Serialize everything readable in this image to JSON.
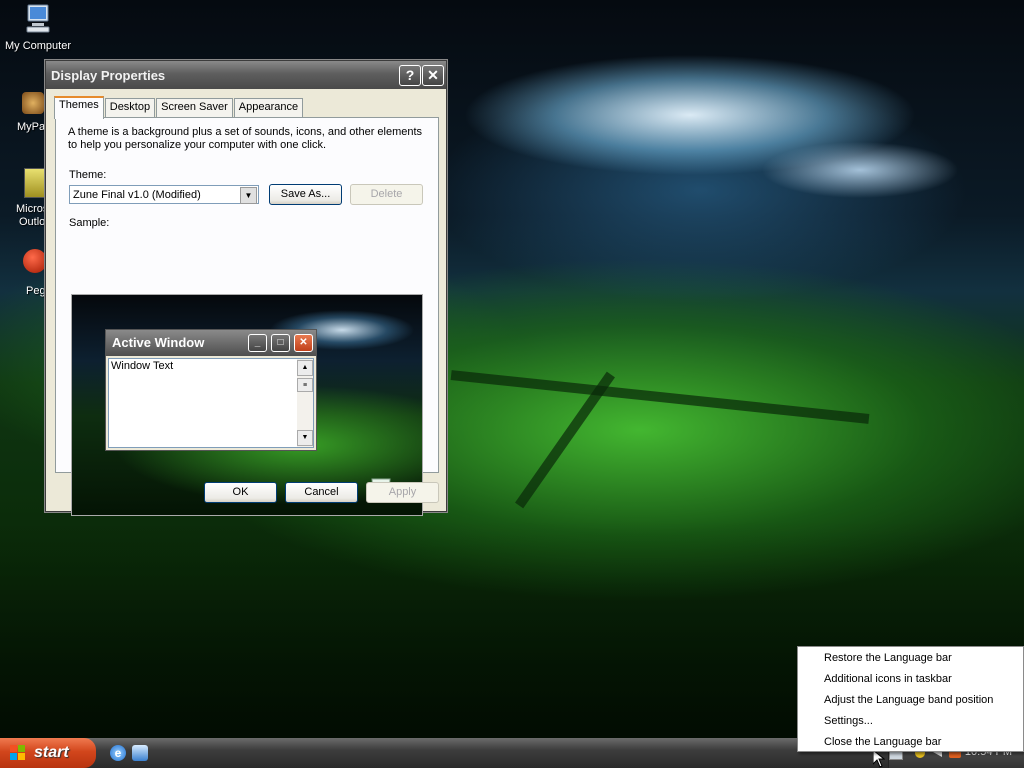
{
  "desktop": {
    "icons": [
      {
        "label": "My Computer"
      },
      {
        "label": "MyPa"
      },
      {
        "label": "Micros"
      },
      {
        "label": "Outlo"
      },
      {
        "label": "Peg"
      }
    ]
  },
  "dialog": {
    "title": "Display Properties",
    "help_btn": "?",
    "close_btn": "✕",
    "tabs": [
      "Themes",
      "Desktop",
      "Screen Saver",
      "Appearance"
    ],
    "description": "A theme is a background plus a set of sounds, icons, and other elements to help you personalize your computer with one click.",
    "theme_label": "Theme:",
    "theme_value": "Zune Final v1.0 (Modified)",
    "save_as": "Save As...",
    "delete": "Delete",
    "sample_label": "Sample:",
    "sample": {
      "window_title": "Active Window",
      "window_text": "Window Text"
    },
    "ok": "OK",
    "cancel": "Cancel",
    "apply": "Apply"
  },
  "taskbar": {
    "start_label": "start",
    "clock": "10:54 PM"
  },
  "context_menu": {
    "items": [
      "Restore the Language bar",
      "Additional icons in taskbar",
      "Adjust the Language band position",
      "Settings...",
      "Close the Language bar"
    ]
  }
}
